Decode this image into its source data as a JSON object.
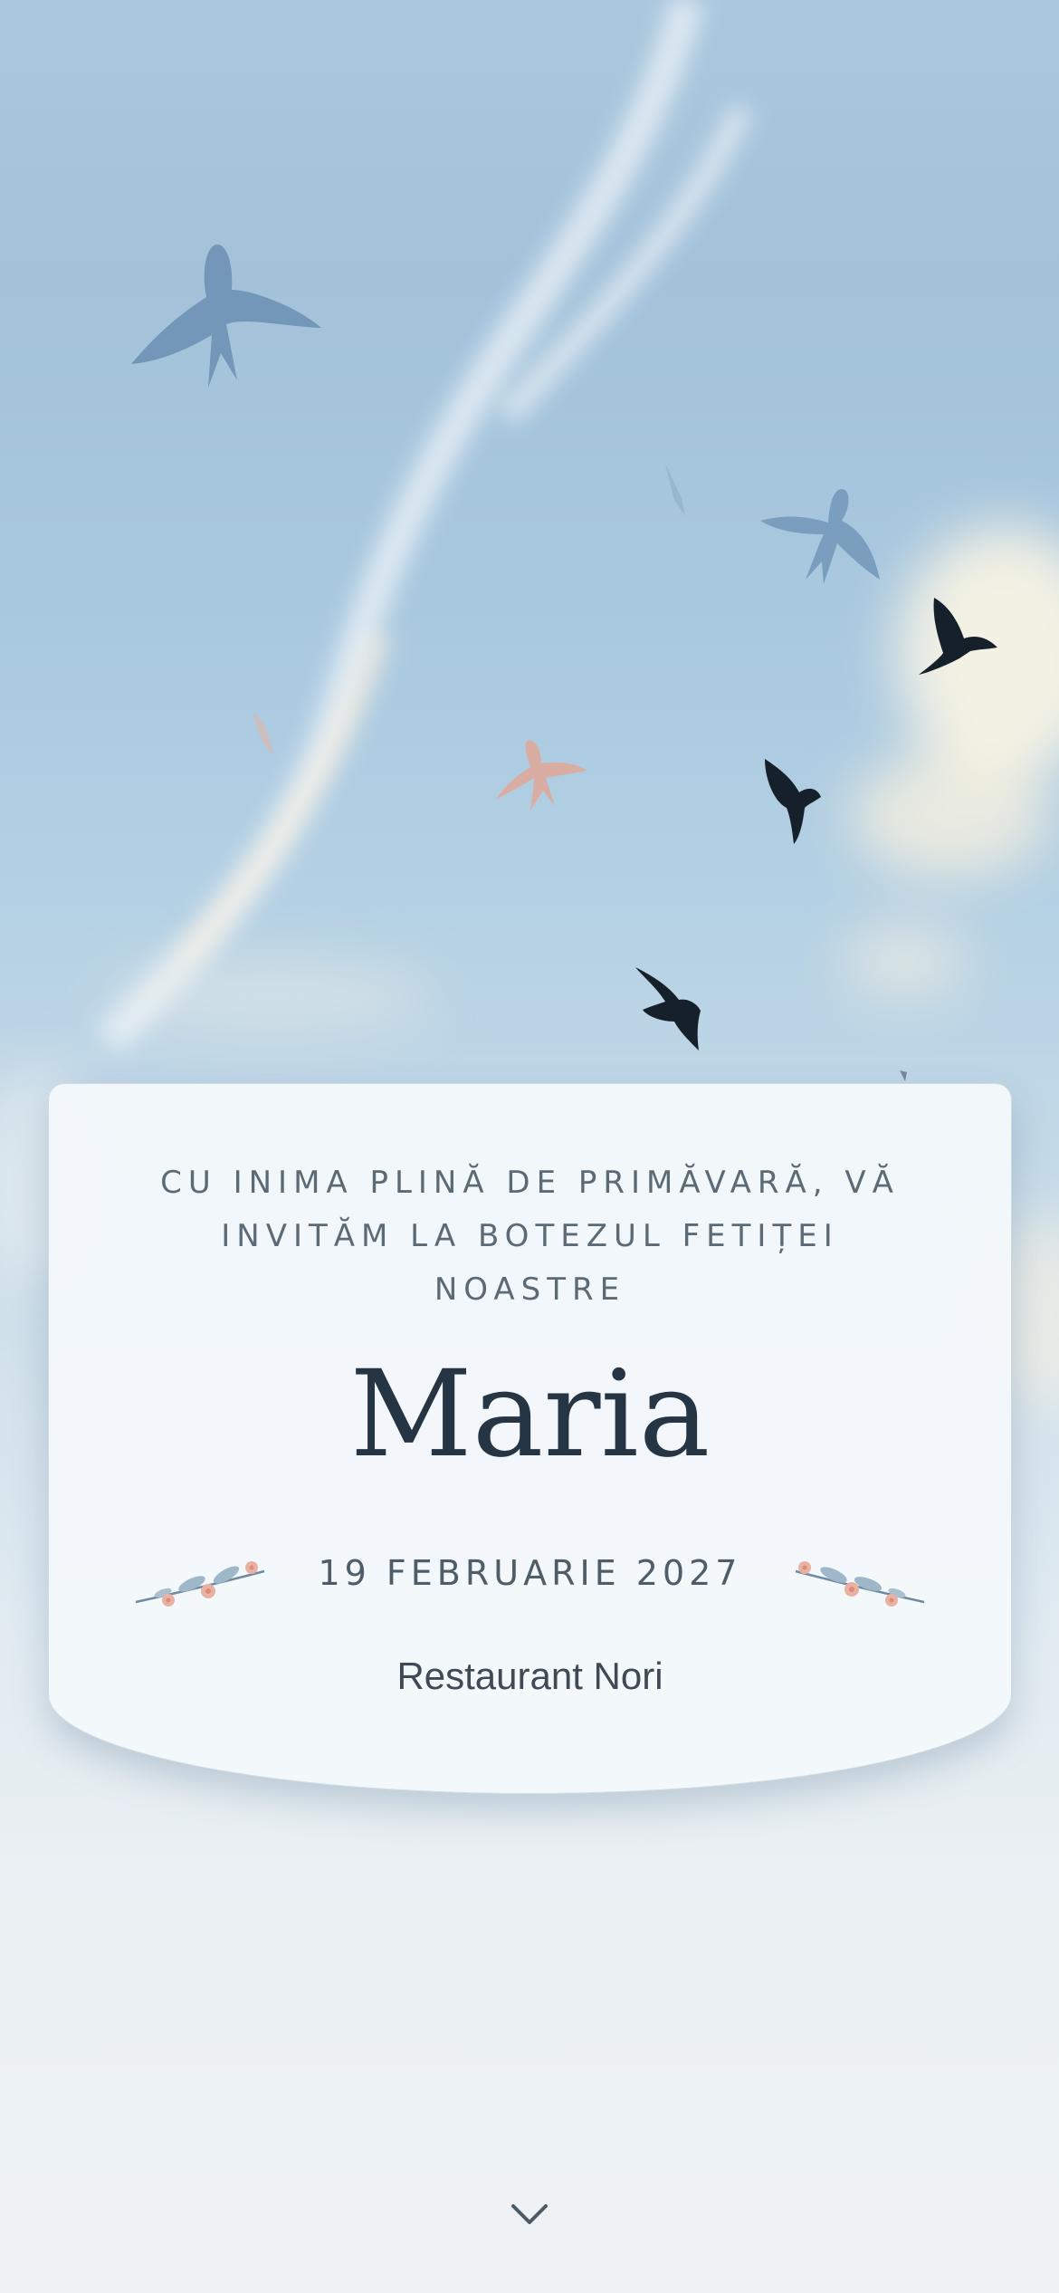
{
  "invitation": {
    "intro": "CU INIMA PLINĂ DE PRIMĂVARĂ, VĂ INVITĂM LA BOTEZUL FETIȚEI NOASTRE",
    "name": "Maria",
    "date": "19 FEBRUARIE 2027",
    "venue": "Restaurant Nori"
  },
  "icons": {
    "scroll": "chevron-down-icon",
    "decoration": "flower-sprig-icon",
    "birds": "swallow-silhouette-icon"
  },
  "colors": {
    "sky": "#a9c7dd",
    "card": "#f4f8fb",
    "name_text": "#263544",
    "accent_pink": "#e7b0a4",
    "bird_blue": "#6b8fb3",
    "bird_dark": "#15202b"
  }
}
